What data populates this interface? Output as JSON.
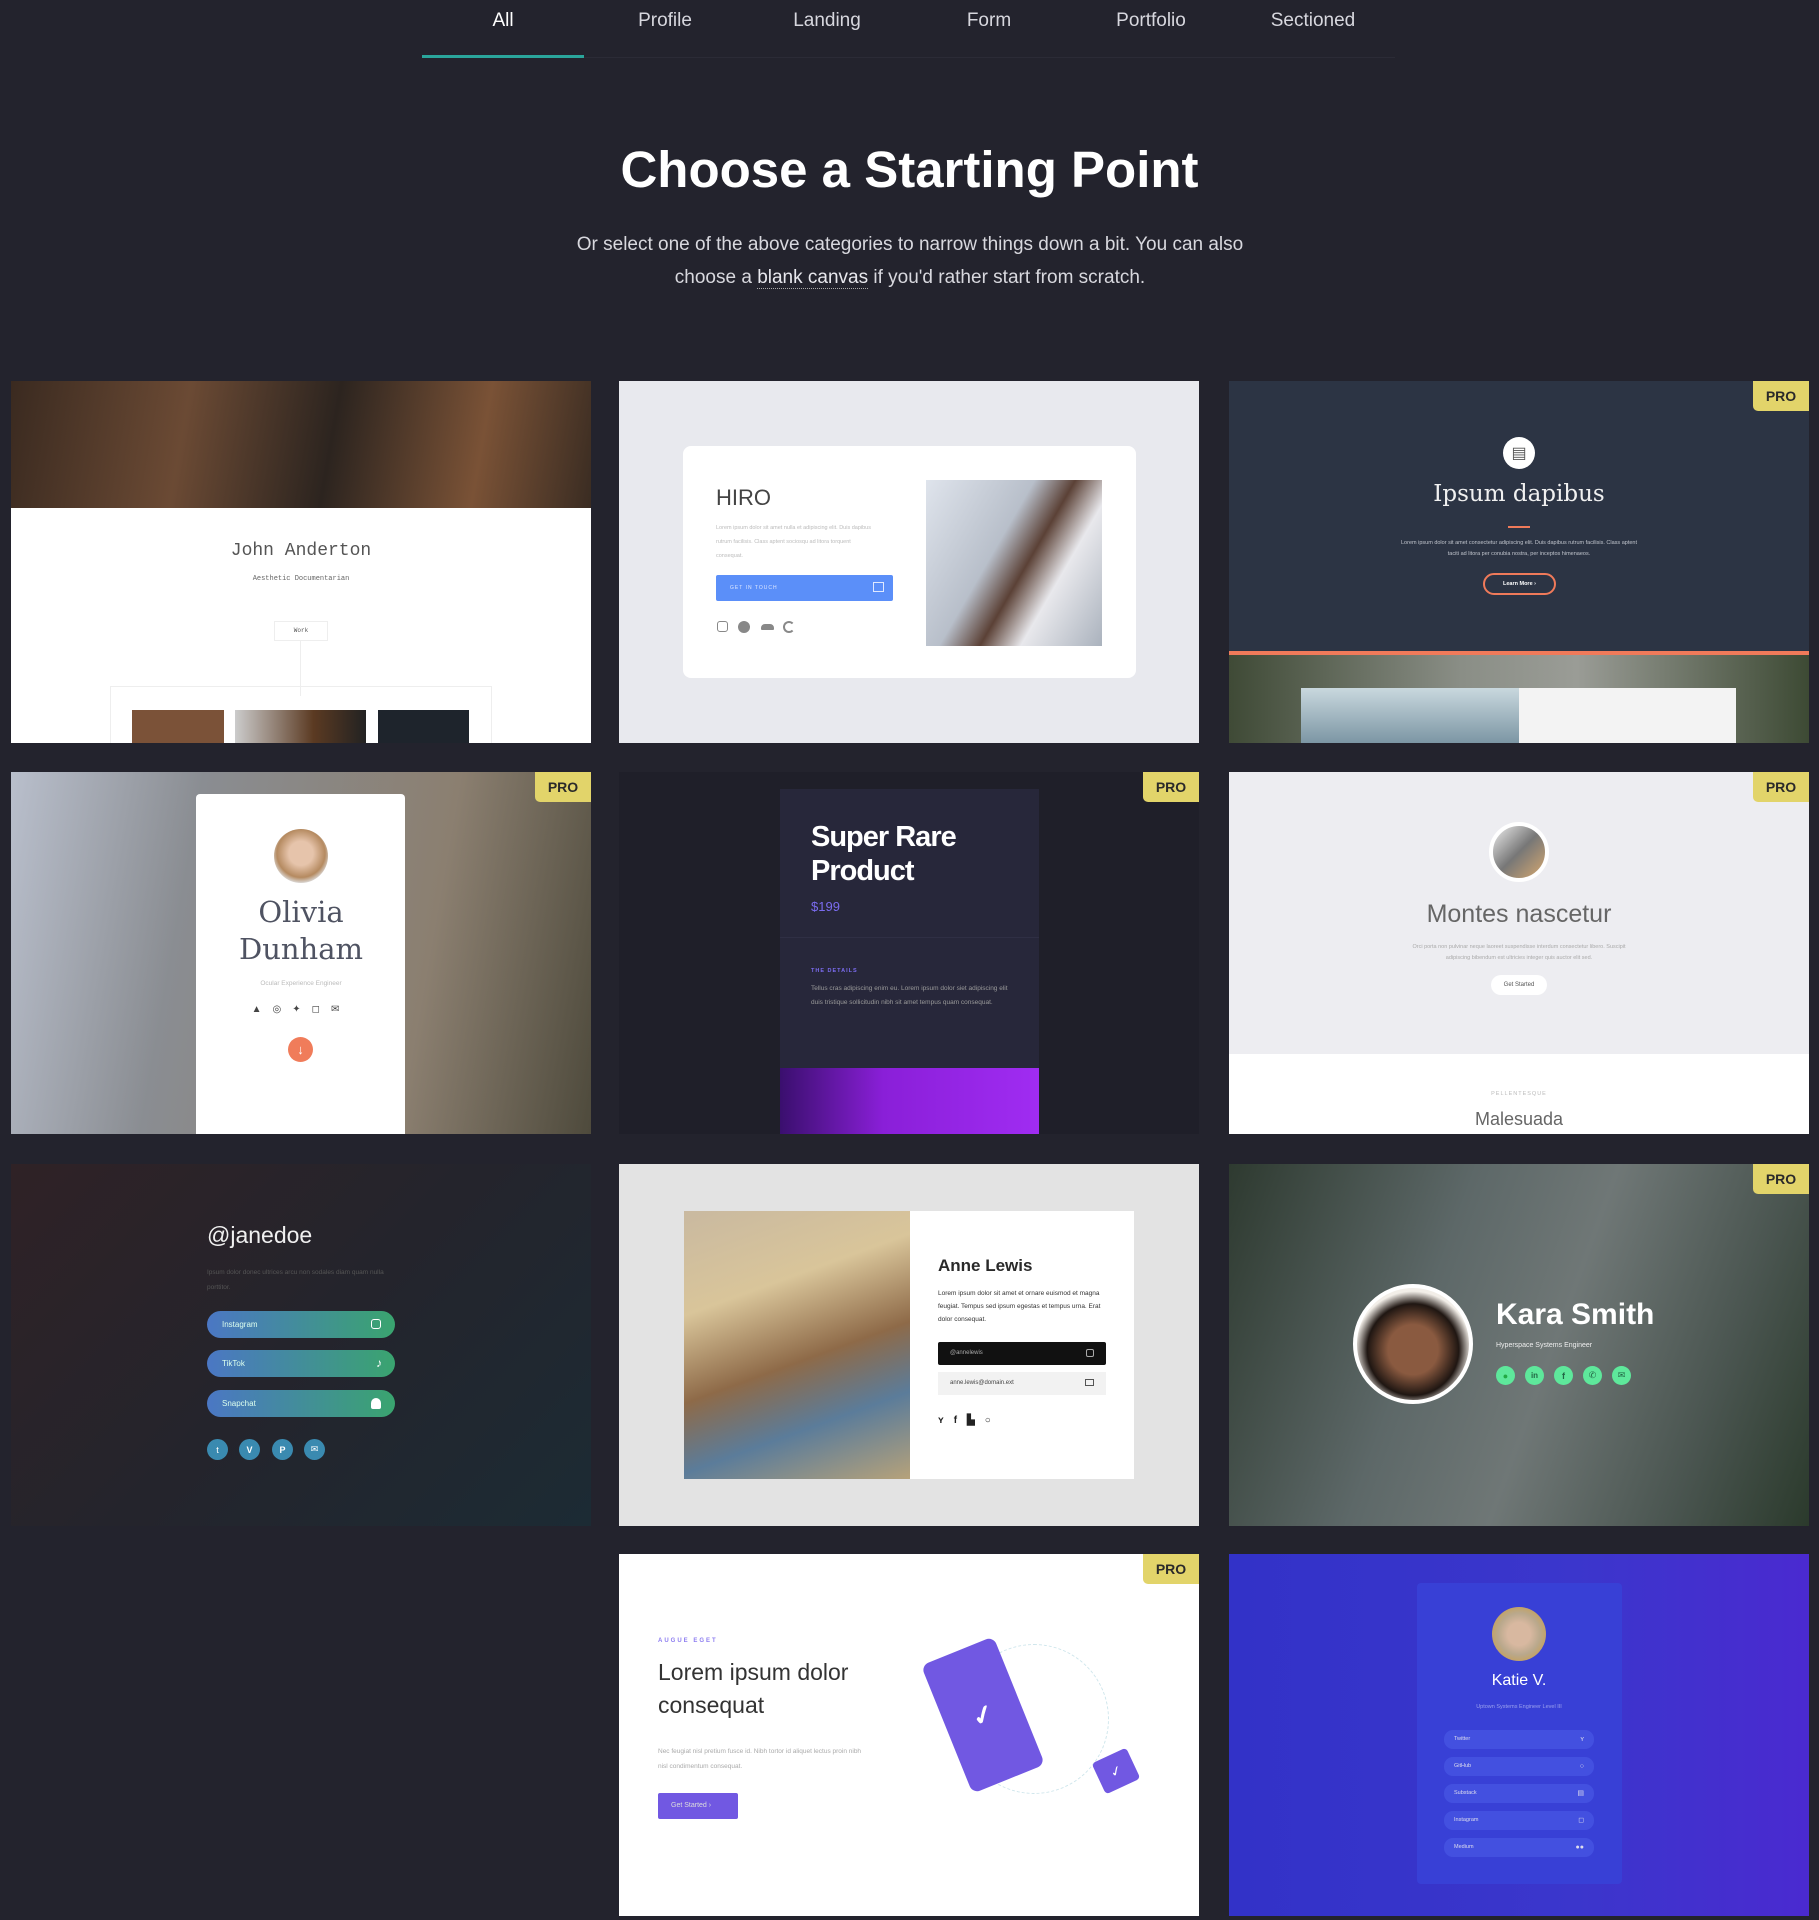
{
  "tabs": [
    {
      "label": "All",
      "active": true
    },
    {
      "label": "Profile"
    },
    {
      "label": "Landing"
    },
    {
      "label": "Form"
    },
    {
      "label": "Portfolio"
    },
    {
      "label": "Sectioned"
    }
  ],
  "header": {
    "title": "Choose a Starting Point",
    "subtitle_before": "Or select one of the above categories to narrow things down a bit. You can also choose a ",
    "link": "blank canvas",
    "subtitle_after": " if you'd rather start from scratch."
  },
  "pro_label": "PRO",
  "colors": {
    "background": "#23232d",
    "tab_accent": "#2aa59b",
    "pro_badge": "#e2d46a"
  },
  "cards": {
    "john": {
      "name": "John Anderton",
      "role": "Aesthetic Documentarian",
      "button": "Work",
      "pro": false
    },
    "hiro": {
      "title": "HIRO",
      "text": "Lorem ipsum dolor sit amet nulla et adipiscing elit. Duis dapibus rutrum facilisis. Class aptent sociosqu ad litora torquent consequat.",
      "button": "GET IN TOUCH",
      "pro": false
    },
    "ipsum": {
      "title": "Ipsum dapibus",
      "text": "Lorem ipsum dolor sit amet consectetur adipiscing elit. Duis dapibus rutrum facilisis. Class aptent taciti ad litora per conubia nostra, per inceptos himenaeos.",
      "button": "Learn More",
      "pro": true
    },
    "olivia": {
      "name_1": "Olivia",
      "name_2": "Dunham",
      "role": "Ocular Experience Engineer",
      "pro": true
    },
    "product": {
      "title_1": "Super Rare",
      "title_2": "Product",
      "price": "$199",
      "details_label": "THE DETAILS",
      "text": "Tellus cras adipiscing enim eu. Lorem ipsum dolor siet adipiscing elit duis tristique sollicitudin nibh sit amet tempus quam consequat.",
      "pro": true
    },
    "montes": {
      "title": "Montes nascetur",
      "text": "Orci porta non pulvinar neque laoreet suspendisse interdum consectetur libero. Suscipit adipiscing bibendum est ultricies integer quis auctor elit sed.",
      "button": "Get Started",
      "eyebrow": "PELLENTESQUE",
      "subtitle": "Malesuada",
      "pro": true
    },
    "jane": {
      "handle": "@janedoe",
      "text": "Ipsum dolor donec ultrices arcu non sodales diam quam nulla porttitor.",
      "links": [
        "Instagram",
        "TikTok",
        "Snapchat"
      ],
      "pro": false
    },
    "anne": {
      "name": "Anne Lewis",
      "text": "Lorem ipsum dolor sit amet et ornare euismod et magna feugiat. Tempus sed ipsum egestas et tempus urna. Erat dolor consequat.",
      "handle": "@annelewis",
      "email": "anne.lewis@domain.ext",
      "pro": false
    },
    "kara": {
      "name": "Kara Smith",
      "role": "Hyperspace Systems Engineer",
      "pro": true
    },
    "lorem": {
      "eyebrow": "AUGUE EGET",
      "title_1": "Lorem ipsum dolor",
      "title_2": "consequat",
      "text": "Nec feugiat nisl pretium fusce id. Nibh tortor id aliquet lectus proin nibh nisl condimentum consequat.",
      "button": "Get Started",
      "pro": true
    },
    "katie": {
      "name": "Katie V.",
      "role": "Uptown Systems Engineer Level III",
      "links": [
        "Twitter",
        "GitHub",
        "Substack",
        "Instagram",
        "Medium"
      ],
      "pro": false
    }
  }
}
